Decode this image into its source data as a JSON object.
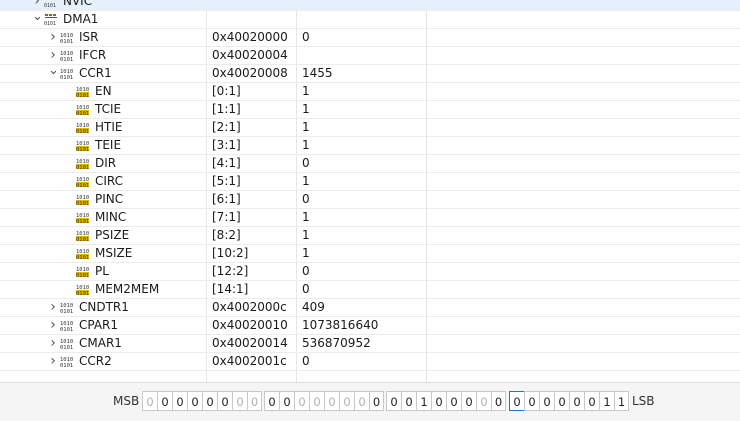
{
  "rows": [
    {
      "label": "NVIC",
      "address": "",
      "value": "",
      "expanded": false,
      "icon": "peripheral-icon",
      "selected": true
    },
    {
      "label": "DMA1",
      "address": "",
      "value": "",
      "expanded": true,
      "icon": "peripheral-icon",
      "selected": false
    },
    {
      "label": "ISR",
      "address": "0x40020000",
      "value": "0",
      "expanded": false,
      "icon": "register-icon",
      "selected": false
    },
    {
      "label": "IFCR",
      "address": "0x40020004",
      "value": "",
      "expanded": false,
      "icon": "register-icon",
      "selected": false
    },
    {
      "label": "CCR1",
      "address": "0x40020008",
      "value": "1455",
      "expanded": true,
      "icon": "register-icon",
      "selected": false
    },
    {
      "label": "EN",
      "address": "[0:1]",
      "value": "1",
      "icon": "field-icon"
    },
    {
      "label": "TCIE",
      "address": "[1:1]",
      "value": "1",
      "icon": "field-icon"
    },
    {
      "label": "HTIE",
      "address": "[2:1]",
      "value": "1",
      "icon": "field-icon"
    },
    {
      "label": "TEIE",
      "address": "[3:1]",
      "value": "1",
      "icon": "field-icon"
    },
    {
      "label": "DIR",
      "address": "[4:1]",
      "value": "0",
      "icon": "field-icon"
    },
    {
      "label": "CIRC",
      "address": "[5:1]",
      "value": "1",
      "icon": "field-icon"
    },
    {
      "label": "PINC",
      "address": "[6:1]",
      "value": "0",
      "icon": "field-icon"
    },
    {
      "label": "MINC",
      "address": "[7:1]",
      "value": "1",
      "icon": "field-icon"
    },
    {
      "label": "PSIZE",
      "address": "[8:2]",
      "value": "1",
      "icon": "field-icon"
    },
    {
      "label": "MSIZE",
      "address": "[10:2]",
      "value": "1",
      "icon": "field-icon"
    },
    {
      "label": "PL",
      "address": "[12:2]",
      "value": "0",
      "icon": "field-icon"
    },
    {
      "label": "MEM2MEM",
      "address": "[14:1]",
      "value": "0",
      "icon": "field-icon"
    },
    {
      "label": "CNDTR1",
      "address": "0x4002000c",
      "value": "409",
      "expanded": false,
      "icon": "register-icon"
    },
    {
      "label": "CPAR1",
      "address": "0x40020010",
      "value": "1073816640",
      "expanded": false,
      "icon": "register-icon"
    },
    {
      "label": "CMAR1",
      "address": "0x40020014",
      "value": "536870952",
      "expanded": false,
      "icon": "register-icon"
    },
    {
      "label": "CCR2",
      "address": "0x4002001c",
      "value": "0",
      "expanded": false,
      "icon": "register-icon"
    }
  ],
  "bits": {
    "msb_label": "MSB",
    "lsb_label": "LSB",
    "values": [
      "0",
      "0",
      "0",
      "0",
      "0",
      "0",
      "0",
      "0",
      "0",
      "0",
      "0",
      "0",
      "0",
      "0",
      "0",
      "0",
      "0",
      "0",
      "1",
      "0",
      "0",
      "0",
      "0",
      "0",
      "0",
      "0",
      "0",
      "0",
      "0",
      "0",
      "1",
      "1"
    ],
    "dim": [
      true,
      false,
      false,
      false,
      false,
      false,
      true,
      true,
      false,
      false,
      true,
      true,
      true,
      true,
      true,
      false,
      false,
      false,
      false,
      false,
      false,
      false,
      true,
      false,
      false,
      false,
      false,
      false,
      false,
      false,
      false,
      false
    ]
  },
  "colors": {
    "selection": "#e6f0fb",
    "selected_bit_border": "#2a6fc9",
    "register_icon": "#8a6a00"
  }
}
